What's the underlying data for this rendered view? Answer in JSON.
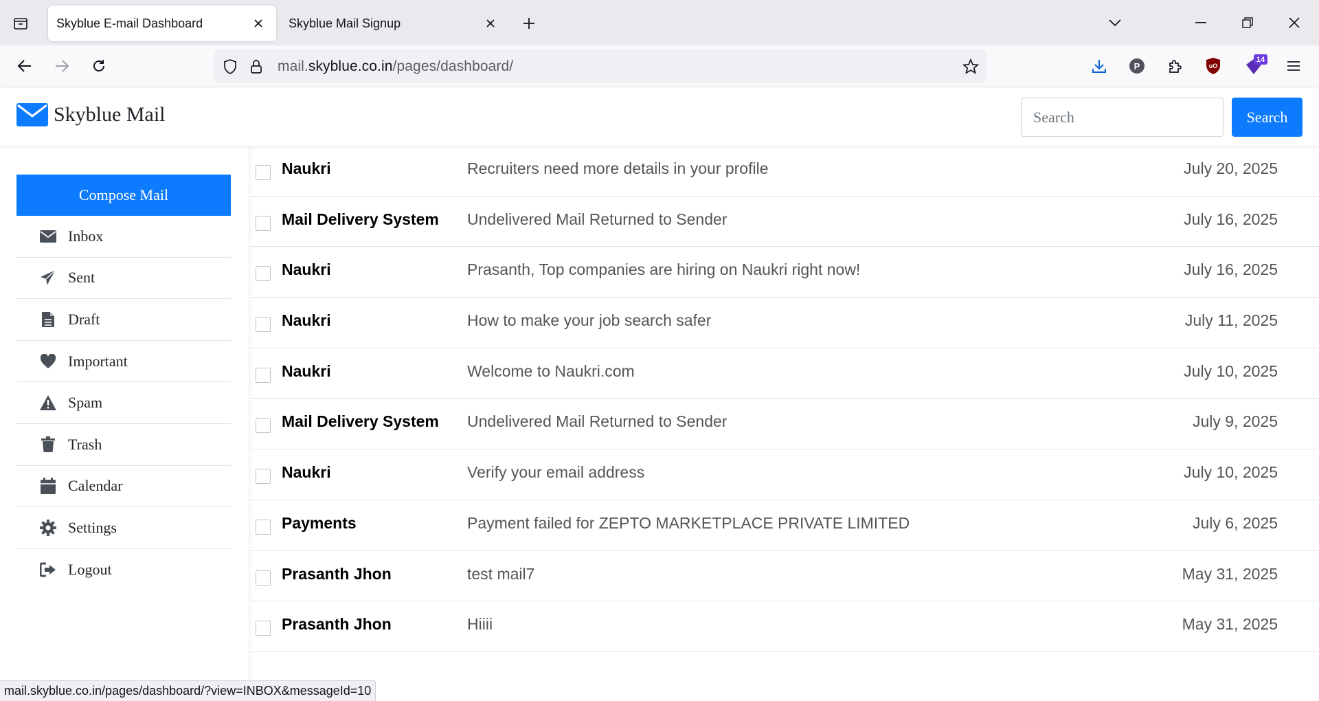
{
  "browser": {
    "tabs": [
      {
        "title": "Skyblue E-mail Dashboard",
        "active": true
      },
      {
        "title": "Skyblue Mail Signup",
        "active": false
      }
    ],
    "url": {
      "prefix": "mail.",
      "host": "skyblue.co.in",
      "path": "/pages/dashboard/"
    },
    "extension_badge": "14",
    "status_url": "mail.skyblue.co.in/pages/dashboard/?view=INBOX&messageId=10"
  },
  "header": {
    "brand": "Skyblue Mail",
    "search_placeholder": "Search",
    "search_button": "Search"
  },
  "sidebar": {
    "compose_label": "Compose Mail",
    "items": [
      {
        "label": "Inbox",
        "icon": "envelope-icon"
      },
      {
        "label": "Sent",
        "icon": "paper-plane-icon"
      },
      {
        "label": "Draft",
        "icon": "file-icon"
      },
      {
        "label": "Important",
        "icon": "heart-icon"
      },
      {
        "label": "Spam",
        "icon": "warning-icon"
      },
      {
        "label": "Trash",
        "icon": "trash-icon"
      },
      {
        "label": "Calendar",
        "icon": "calendar-icon"
      },
      {
        "label": "Settings",
        "icon": "gear-icon"
      },
      {
        "label": "Logout",
        "icon": "logout-icon"
      }
    ]
  },
  "mails": [
    {
      "sender": "Naukri",
      "subject": "Recruiters need more details in your profile",
      "date": "July 20, 2025"
    },
    {
      "sender": "Mail Delivery System",
      "subject": "Undelivered Mail Returned to Sender",
      "date": "July 16, 2025"
    },
    {
      "sender": "Naukri",
      "subject": "Prasanth, Top companies are hiring on Naukri right now!",
      "date": "July 16, 2025"
    },
    {
      "sender": "Naukri",
      "subject": "How to make your job search safer",
      "date": "July 11, 2025"
    },
    {
      "sender": "Naukri",
      "subject": "Welcome to Naukri.com",
      "date": "July 10, 2025"
    },
    {
      "sender": "Mail Delivery System",
      "subject": "Undelivered Mail Returned to Sender",
      "date": "July 9, 2025"
    },
    {
      "sender": "Naukri",
      "subject": "Verify your email address",
      "date": "July 10, 2025"
    },
    {
      "sender": "Payments",
      "subject": "Payment failed for ZEPTO MARKETPLACE PRIVATE LIMITED",
      "date": "July 6, 2025"
    },
    {
      "sender": "Prasanth Jhon",
      "subject": "test mail7",
      "date": "May 31, 2025"
    },
    {
      "sender": "Prasanth Jhon",
      "subject": "Hiiii",
      "date": "May 31, 2025"
    }
  ],
  "colors": {
    "accent": "#0d7bfe",
    "icon": "#495057"
  }
}
